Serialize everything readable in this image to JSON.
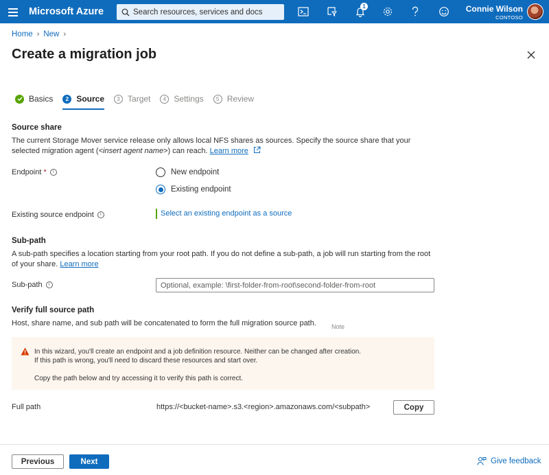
{
  "topbar": {
    "brand": "Microsoft Azure",
    "search_placeholder": "Search resources, services and docs",
    "notification_count": "1",
    "user_name": "Connie Wilson",
    "user_org": "CONTOSO",
    "icons": [
      "terminal-icon",
      "directory-filter-icon",
      "bell-icon",
      "gear-icon",
      "help-icon",
      "feedback-smiley-icon"
    ]
  },
  "breadcrumb": [
    "Home",
    "New"
  ],
  "page_title": "Create a migration job",
  "steps": [
    {
      "number": "",
      "label": "Basics",
      "state": "done"
    },
    {
      "number": "2",
      "label": "Source",
      "state": "active"
    },
    {
      "number": "3",
      "label": "Target",
      "state": "todo"
    },
    {
      "number": "4",
      "label": "Settings",
      "state": "todo"
    },
    {
      "number": "5",
      "label": "Review",
      "state": "todo"
    }
  ],
  "source_share": {
    "heading": "Source share",
    "desc_1": "The current Storage Mover service release only allows local NFS shares as sources. Specify the source share that your selected migration agent (",
    "desc_italic": "<insert agent name>",
    "desc_2": ") can reach. ",
    "learn_more": "Learn more",
    "endpoint_label": "Endpoint",
    "required_mark": "*",
    "radio_new": "New endpoint",
    "radio_existing": "Existing endpoint",
    "selected": "existing",
    "existing_label": "Existing source endpoint",
    "existing_link": "Select an existing endpoint as a source"
  },
  "sub_path": {
    "heading": "Sub-path",
    "desc": "A sub-path specifies a location starting from your root path. If you do not define a sub-path, a job will run starting from the root of your share. ",
    "learn_more": "Learn more",
    "label": "Sub-path",
    "placeholder": "Optional, example: \\first-folder-from-root\\second-folder-from-root"
  },
  "verify": {
    "heading": "Verify full source path",
    "desc": "Host, share name, and sub path will be concatenated to form the full migration source path.",
    "note_label": "Note",
    "warning_line_1": "In this wizard, you'll create an endpoint and a job definition resource. Neither can be changed after creation.",
    "warning_line_2": "If this path is wrong, you'll need to discard these resources and start over.",
    "warning_line_3": "Copy the path below and try accessing it to verify this path is correct.",
    "full_path_label": "Full path",
    "full_path_value": "https://<bucket-name>.s3.<region>.amazonaws.com/<subpath>",
    "copy_label": "Copy"
  },
  "footer": {
    "previous": "Previous",
    "next": "Next",
    "feedback": "Give feedback"
  },
  "colors": {
    "accent": "#0f6cbd",
    "success": "#57a300",
    "warning_bg": "#fdf6ef",
    "warning_icon": "#d83b01"
  }
}
